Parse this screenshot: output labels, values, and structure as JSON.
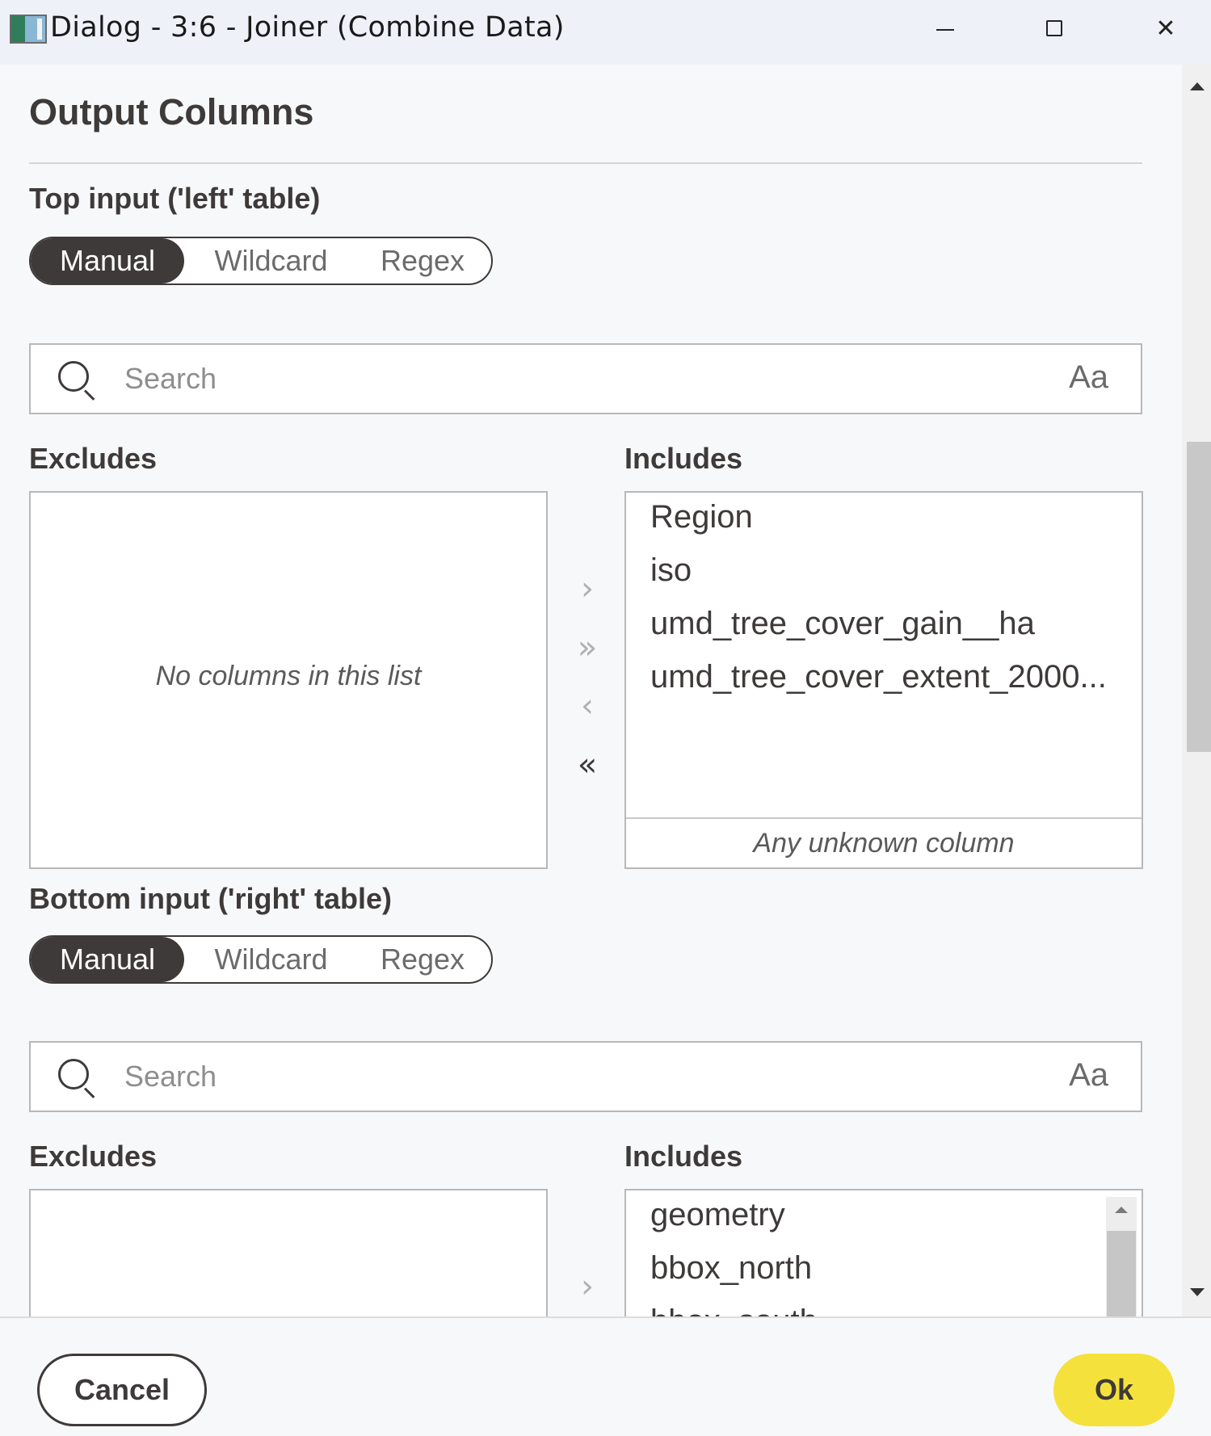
{
  "window": {
    "title": "Dialog - 3:6 - Joiner (Combine Data)"
  },
  "page": {
    "heading": "Output Columns"
  },
  "top": {
    "label": "Top input ('left' table)",
    "modes": [
      "Manual",
      "Wildcard",
      "Regex"
    ],
    "active_mode": "Manual",
    "search": {
      "placeholder": "Search",
      "value": "",
      "case_label": "Aa"
    },
    "excludes": {
      "label": "Excludes",
      "empty_text": "No columns in this list",
      "items": []
    },
    "includes": {
      "label": "Includes",
      "items": [
        "Region",
        "iso",
        "umd_tree_cover_gain__ha",
        "umd_tree_cover_extent_2000..."
      ],
      "unknown_label": "Any unknown column"
    },
    "buttons": {
      "add": "›",
      "add_all": "»",
      "remove": "‹",
      "remove_all": "«"
    }
  },
  "bottom": {
    "label": "Bottom input ('right' table)",
    "modes": [
      "Manual",
      "Wildcard",
      "Regex"
    ],
    "active_mode": "Manual",
    "search": {
      "placeholder": "Search",
      "value": "",
      "case_label": "Aa"
    },
    "excludes": {
      "label": "Excludes",
      "items": []
    },
    "includes": {
      "label": "Includes",
      "items": [
        "geometry",
        "bbox_north",
        "bbox_south"
      ]
    },
    "buttons": {
      "add": "›"
    }
  },
  "footer": {
    "cancel_label": "Cancel",
    "ok_label": "Ok"
  },
  "colors": {
    "text": "#3e3a39",
    "ok_button": "#f5e13b",
    "segment_active": "#3e3a39"
  }
}
